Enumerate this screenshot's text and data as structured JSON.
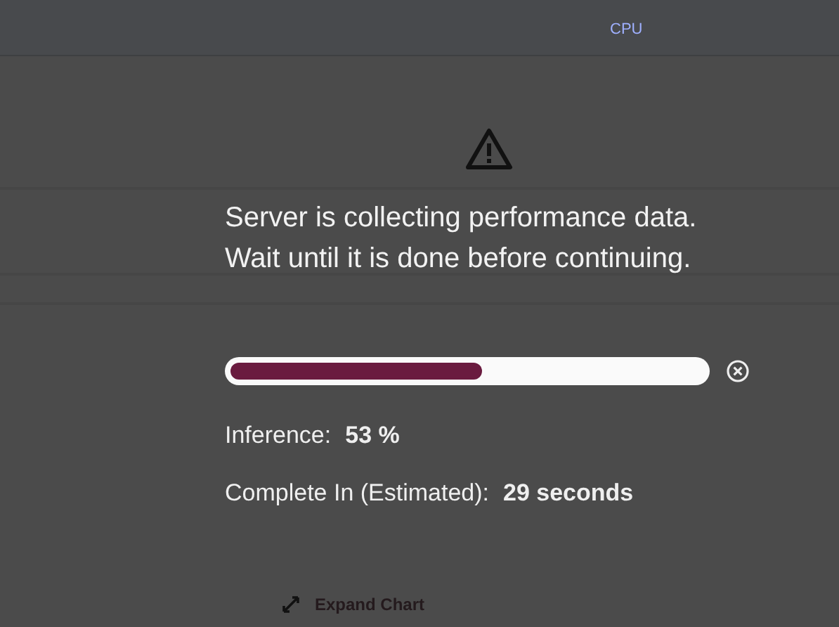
{
  "header": {
    "cells": [
      {
        "lines": [
          "CPU"
        ]
      }
    ]
  },
  "dialog": {
    "message": [
      "Server is collecting performance data.",
      "Wait until it is done before continuing."
    ],
    "progress": {
      "level": 0.53
    },
    "stats": [
      {
        "label": "Inference:",
        "value": "53 %"
      },
      {
        "label": "Complete In (Estimated):",
        "value": "29 seconds"
      }
    ]
  },
  "expand_link": "Expand Chart"
}
